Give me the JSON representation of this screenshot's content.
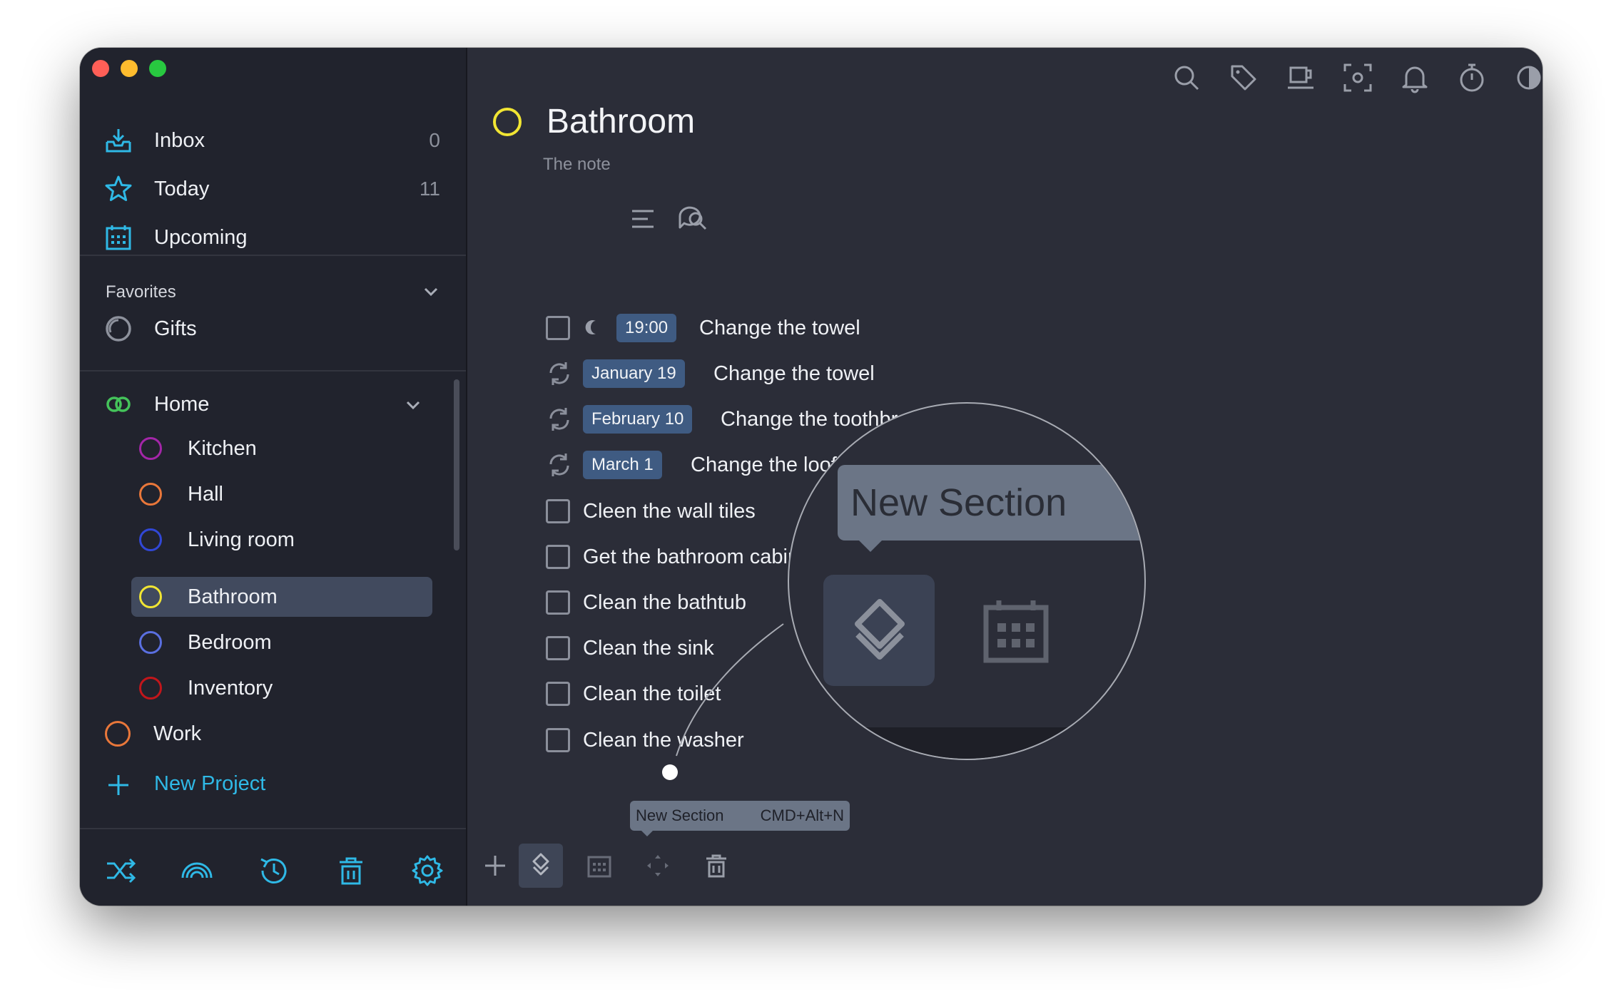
{
  "sidebar": {
    "nav": [
      {
        "label": "Inbox",
        "count": "0",
        "icon": "inbox-icon"
      },
      {
        "label": "Today",
        "count": "11",
        "icon": "star-icon"
      },
      {
        "label": "Upcoming",
        "count": "",
        "icon": "calendar-icon"
      }
    ],
    "favorites": {
      "title": "Favorites",
      "items": [
        {
          "label": "Gifts",
          "icon": "circle-icon"
        }
      ]
    },
    "projects": {
      "home": {
        "label": "Home",
        "icon": "area-icon"
      },
      "home_children": [
        {
          "label": "Kitchen",
          "color": "#a326a8"
        },
        {
          "label": "Hall",
          "color": "#e9773a"
        },
        {
          "label": "Living room",
          "color": "#3147d6"
        },
        {
          "label": "Bathroom",
          "color": "#f1e533"
        },
        {
          "label": "Bedroom",
          "color": "#5a6fe0"
        },
        {
          "label": "Inventory",
          "color": "#c2161b"
        }
      ],
      "work": {
        "label": "Work",
        "color": "#e9773a"
      }
    },
    "new_project": "New Project",
    "toolbar": [
      "shuffle-icon",
      "rainbow-icon",
      "history-icon",
      "trash-icon",
      "gear-icon"
    ]
  },
  "main": {
    "toolbar": [
      "search-icon",
      "tag-icon",
      "coffee-icon",
      "focus-icon",
      "bell-icon",
      "stopwatch-icon",
      "contrast-icon",
      "duplicate-icon"
    ],
    "title": "Bathroom",
    "note": "The note",
    "tasks": [
      {
        "type": "checkbox",
        "evening": true,
        "tag": "19:00",
        "text": "Change the towel"
      },
      {
        "type": "repeat",
        "tag": "January 19",
        "text": "Change the towel"
      },
      {
        "type": "repeat",
        "tag": "February 10",
        "text": "Change the toothbrashes"
      },
      {
        "type": "repeat",
        "tag": "March 1",
        "text": "Change the loofah"
      },
      {
        "type": "checkbox",
        "text": "Cleen the wall tiles"
      },
      {
        "type": "checkbox",
        "text": "Get the bathroom cabinet"
      },
      {
        "type": "checkbox",
        "text": "Clean the bathtub"
      },
      {
        "type": "checkbox",
        "text": "Clean the sink"
      },
      {
        "type": "checkbox",
        "text": "Clean the toilet"
      },
      {
        "type": "checkbox",
        "text": "Clean the washer"
      }
    ],
    "magnifier": {
      "tooltip": "New Section"
    },
    "tooltip": {
      "label": "New Section",
      "shortcut": "CMD+Alt+N"
    },
    "bottom_toolbar": [
      "plus-icon",
      "new-section-icon",
      "calendar-icon",
      "move-icon",
      "trash-icon",
      "cloud-icon"
    ]
  },
  "colors": {
    "accent": "#2fb9e6",
    "tag": "#3f5b82",
    "selected": "#414a5e",
    "sidebar": "#21232d",
    "main": "#2b2d38"
  }
}
